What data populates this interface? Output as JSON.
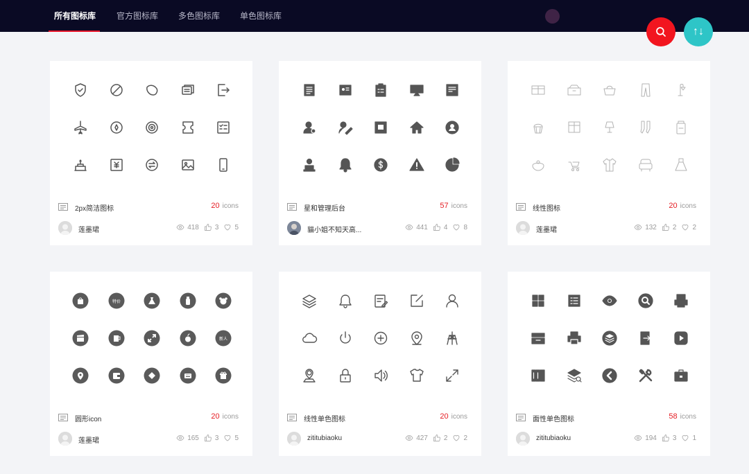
{
  "nav": {
    "tabs": [
      {
        "label": "所有图标库",
        "active": true
      },
      {
        "label": "官方图标库",
        "active": false
      },
      {
        "label": "多色图标库",
        "active": false
      },
      {
        "label": "单色图标库",
        "active": false
      }
    ],
    "active_color": "#e8142a"
  },
  "actions": {
    "search_icon": "search-icon",
    "sort_label": "↑↓",
    "search_color": "#f2151f",
    "sort_color": "#2ec5c7"
  },
  "cards": [
    {
      "title": "2px简洁图标",
      "count": "20",
      "count_unit": "icons",
      "author": "莲墨珺",
      "views": "418",
      "likes": "3",
      "favorites": "5",
      "icon_style": "outline",
      "icons": [
        "shield-icon",
        "forbidden-icon",
        "leaf-icon",
        "cards-icon",
        "logout-icon",
        "airplane-icon",
        "compass-icon",
        "target-icon",
        "ticket-icon",
        "checklist-icon",
        "cake-icon",
        "yen-card-icon",
        "exchange-icon",
        "image-icon",
        "phone-icon"
      ]
    },
    {
      "title": "星和管理后台",
      "count": "57",
      "count_unit": "icons",
      "author": "貓小姐不知天高...",
      "views": "441",
      "likes": "4",
      "favorites": "8",
      "icon_style": "solid",
      "icons": [
        "document-icon",
        "id-card-icon",
        "clipboard-icon",
        "screen-icon",
        "report-icon",
        "user-settings-icon",
        "edit-user-icon",
        "photo-doc-icon",
        "home-icon",
        "user-circle-icon",
        "stamp-icon",
        "bell-icon",
        "dollar-icon",
        "warning-icon",
        "pie-chart-icon"
      ]
    },
    {
      "title": "线性图标",
      "count": "20",
      "count_unit": "icons",
      "author": "莲墨珺",
      "views": "132",
      "likes": "2",
      "favorites": "2",
      "icon_style": "thin",
      "icons": [
        "cabinet-icon",
        "drawer-icon",
        "handbag-icon",
        "trousers-icon",
        "lamp-icon",
        "cupcake-icon",
        "wardrobe-icon",
        "table-lamp-icon",
        "socks-icon",
        "jar-icon",
        "teapot-icon",
        "stroller-icon",
        "shirt-icon",
        "sofa-icon",
        "dress-icon"
      ]
    },
    {
      "title": "圆形icon",
      "count": "20",
      "count_unit": "icons",
      "author": "莲墨珺",
      "views": "165",
      "likes": "3",
      "favorites": "5",
      "icon_style": "circle",
      "icons": [
        "bag-icon",
        "tag-icon",
        "dress-icon",
        "bottle-icon",
        "bear-icon",
        "clapper-icon",
        "cup-icon",
        "expand-icon",
        "apple-icon",
        "new-icon",
        "location-icon",
        "wallet-icon",
        "diamond-icon",
        "keyboard-icon",
        "gift-icon"
      ]
    },
    {
      "title": "线性单色图标",
      "count": "20",
      "count_unit": "icons",
      "author": "zititubiaoku",
      "views": "427",
      "likes": "2",
      "favorites": "2",
      "icon_style": "outline",
      "icons": [
        "layers-icon",
        "bell-icon",
        "note-edit-icon",
        "square-edit-icon",
        "user-icon",
        "cloud-icon",
        "power-icon",
        "add-circle-icon",
        "location-icon",
        "tower-icon",
        "map-user-icon",
        "lock-icon",
        "speaker-icon",
        "tshirt-icon",
        "fullscreen-icon"
      ]
    },
    {
      "title": "面性单色图标",
      "count": "58",
      "count_unit": "icons",
      "author": "zititubiaoku",
      "views": "194",
      "likes": "3",
      "favorites": "1",
      "icon_style": "solid",
      "icons": [
        "grid-icon",
        "list-icon",
        "eye-icon",
        "search-circle-icon",
        "printer-doc-icon",
        "inbox-icon",
        "printer-icon",
        "layers-circle-icon",
        "export-icon",
        "play-icon",
        "books-icon",
        "layers-search-icon",
        "back-icon",
        "tools-icon",
        "briefcase-icon"
      ]
    }
  ]
}
